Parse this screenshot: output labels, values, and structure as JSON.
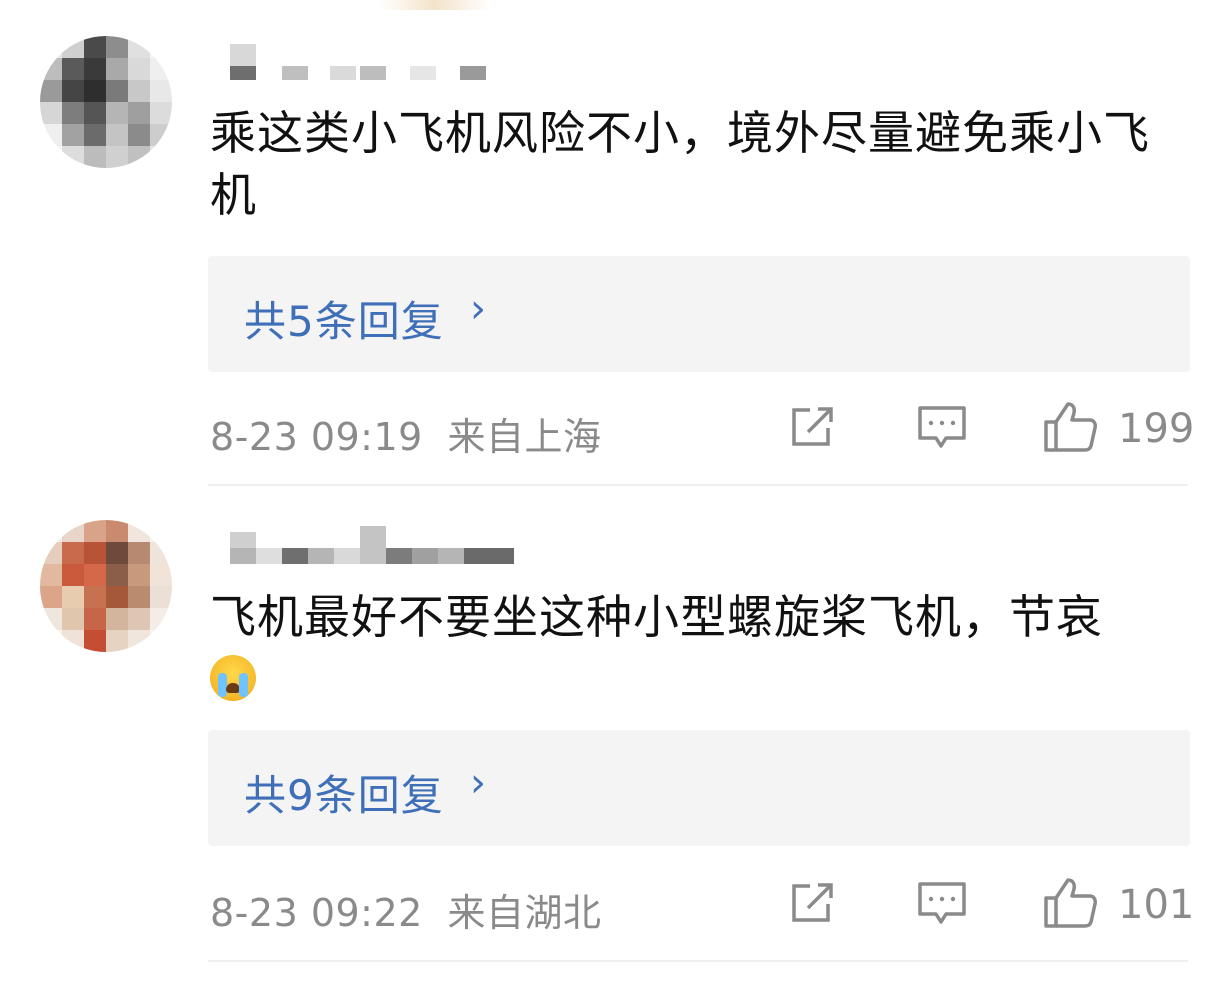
{
  "comments": [
    {
      "text": "乘这类小飞机风险不小，境外尽量避免乘小飞机",
      "replies_label": "共5条回复",
      "chevron": "›",
      "timestamp": "8-23 09:19",
      "location": "来自上海",
      "likes": "199"
    },
    {
      "text": "飞机最好不要坐这种小型螺旋桨飞机，节哀",
      "emoji": "crying-face-emoji",
      "replies_label": "共9条回复",
      "chevron": "›",
      "timestamp": "8-23 09:22",
      "location": "来自湖北",
      "likes": "101"
    }
  ],
  "icons": {
    "share": "share-icon",
    "comment": "comment-icon",
    "like": "thumbs-up-icon"
  },
  "colors": {
    "link": "#3f6fb8",
    "meta": "#8a8a8a",
    "reply_bg": "#f4f4f4",
    "text": "#111111"
  }
}
